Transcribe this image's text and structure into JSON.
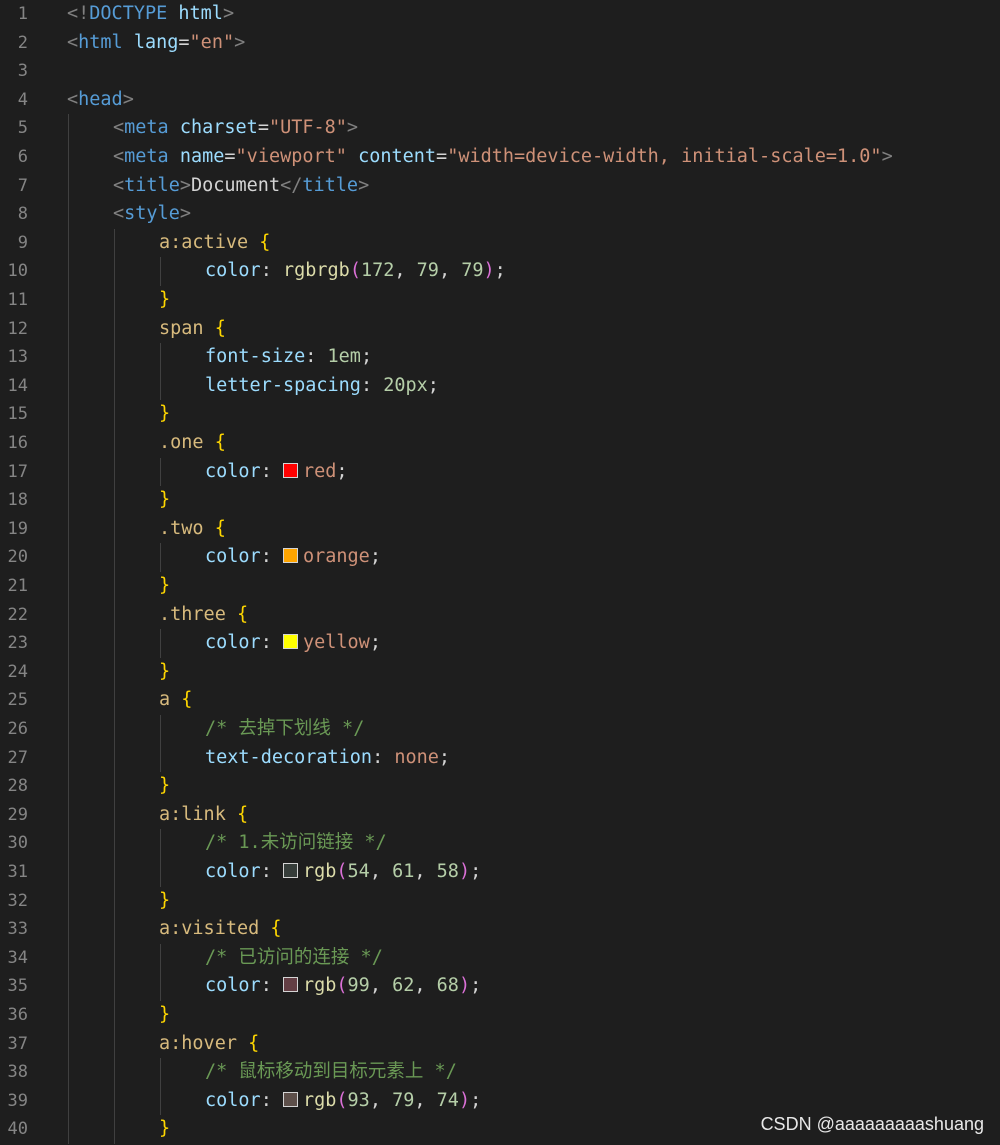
{
  "editor": {
    "theme_colors": {
      "background": "#1e1e1e",
      "line_number": "#858585",
      "tag": "#569cd6",
      "attribute": "#9cdcfe",
      "string": "#ce9178",
      "selector": "#d7ba7d",
      "brace": "#ffd700",
      "number": "#b5cea8",
      "function": "#dcdcaa",
      "paren": "#da70d6",
      "comment": "#6a9955"
    },
    "lines": [
      {
        "n": "1",
        "indent": 0,
        "tokens": [
          [
            "punct",
            "<!"
          ],
          [
            "tag",
            "DOCTYPE"
          ],
          [
            "text",
            " "
          ],
          [
            "attr",
            "html"
          ],
          [
            "punct",
            ">"
          ]
        ]
      },
      {
        "n": "2",
        "indent": 0,
        "tokens": [
          [
            "punct",
            "<"
          ],
          [
            "tag",
            "html"
          ],
          [
            "text",
            " "
          ],
          [
            "attr",
            "lang"
          ],
          [
            "eq",
            "="
          ],
          [
            "str",
            "\"en\""
          ],
          [
            "punct",
            ">"
          ]
        ]
      },
      {
        "n": "3",
        "indent": 0,
        "tokens": []
      },
      {
        "n": "4",
        "indent": 0,
        "tokens": [
          [
            "punct",
            "<"
          ],
          [
            "tag",
            "head"
          ],
          [
            "punct",
            ">"
          ]
        ]
      },
      {
        "n": "5",
        "indent": 1,
        "tokens": [
          [
            "punct",
            "<"
          ],
          [
            "tag",
            "meta"
          ],
          [
            "text",
            " "
          ],
          [
            "attr",
            "charset"
          ],
          [
            "eq",
            "="
          ],
          [
            "str",
            "\"UTF-8\""
          ],
          [
            "punct",
            ">"
          ]
        ]
      },
      {
        "n": "6",
        "indent": 1,
        "tokens": [
          [
            "punct",
            "<"
          ],
          [
            "tag",
            "meta"
          ],
          [
            "text",
            " "
          ],
          [
            "attr",
            "name"
          ],
          [
            "eq",
            "="
          ],
          [
            "str",
            "\"viewport\""
          ],
          [
            "text",
            " "
          ],
          [
            "attr",
            "content"
          ],
          [
            "eq",
            "="
          ],
          [
            "str",
            "\"width=device-width, initial-scale=1.0\""
          ],
          [
            "punct",
            ">"
          ]
        ]
      },
      {
        "n": "7",
        "indent": 1,
        "tokens": [
          [
            "punct",
            "<"
          ],
          [
            "tag",
            "title"
          ],
          [
            "punct",
            ">"
          ],
          [
            "text",
            "Document"
          ],
          [
            "punct",
            "</"
          ],
          [
            "tag",
            "title"
          ],
          [
            "punct",
            ">"
          ]
        ]
      },
      {
        "n": "8",
        "indent": 1,
        "tokens": [
          [
            "punct",
            "<"
          ],
          [
            "tag",
            "style"
          ],
          [
            "punct",
            ">"
          ]
        ]
      },
      {
        "n": "9",
        "indent": 2,
        "tokens": [
          [
            "sel",
            "a:active"
          ],
          [
            "text",
            " "
          ],
          [
            "brace",
            "{"
          ]
        ]
      },
      {
        "n": "10",
        "indent": 3,
        "tokens": [
          [
            "prop",
            "color"
          ],
          [
            "text",
            ": "
          ],
          [
            "func",
            "rgbrgb"
          ],
          [
            "paren",
            "("
          ],
          [
            "num",
            "172"
          ],
          [
            "text",
            ", "
          ],
          [
            "num",
            "79"
          ],
          [
            "text",
            ", "
          ],
          [
            "num",
            "79"
          ],
          [
            "paren",
            ")"
          ],
          [
            "text",
            ";"
          ]
        ]
      },
      {
        "n": "11",
        "indent": 2,
        "tokens": [
          [
            "brace",
            "}"
          ]
        ]
      },
      {
        "n": "12",
        "indent": 2,
        "tokens": [
          [
            "sel",
            "span"
          ],
          [
            "text",
            " "
          ],
          [
            "brace",
            "{"
          ]
        ]
      },
      {
        "n": "13",
        "indent": 3,
        "tokens": [
          [
            "prop",
            "font-size"
          ],
          [
            "text",
            ": "
          ],
          [
            "num",
            "1em"
          ],
          [
            "text",
            ";"
          ]
        ]
      },
      {
        "n": "14",
        "indent": 3,
        "tokens": [
          [
            "prop",
            "letter-spacing"
          ],
          [
            "text",
            ": "
          ],
          [
            "num",
            "20px"
          ],
          [
            "text",
            ";"
          ]
        ]
      },
      {
        "n": "15",
        "indent": 2,
        "tokens": [
          [
            "brace",
            "}"
          ]
        ]
      },
      {
        "n": "16",
        "indent": 2,
        "tokens": [
          [
            "sel",
            ".one"
          ],
          [
            "text",
            " "
          ],
          [
            "brace",
            "{"
          ]
        ]
      },
      {
        "n": "17",
        "indent": 3,
        "tokens": [
          [
            "prop",
            "color"
          ],
          [
            "text",
            ": "
          ],
          [
            "swatch",
            "#ff0000"
          ],
          [
            "str",
            "red"
          ],
          [
            "text",
            ";"
          ]
        ]
      },
      {
        "n": "18",
        "indent": 2,
        "tokens": [
          [
            "brace",
            "}"
          ]
        ]
      },
      {
        "n": "19",
        "indent": 2,
        "tokens": [
          [
            "sel",
            ".two"
          ],
          [
            "text",
            " "
          ],
          [
            "brace",
            "{"
          ]
        ]
      },
      {
        "n": "20",
        "indent": 3,
        "tokens": [
          [
            "prop",
            "color"
          ],
          [
            "text",
            ": "
          ],
          [
            "swatch",
            "#ffa500"
          ],
          [
            "str",
            "orange"
          ],
          [
            "text",
            ";"
          ]
        ]
      },
      {
        "n": "21",
        "indent": 2,
        "tokens": [
          [
            "brace",
            "}"
          ]
        ]
      },
      {
        "n": "22",
        "indent": 2,
        "tokens": [
          [
            "sel",
            ".three"
          ],
          [
            "text",
            " "
          ],
          [
            "brace",
            "{"
          ]
        ]
      },
      {
        "n": "23",
        "indent": 3,
        "tokens": [
          [
            "prop",
            "color"
          ],
          [
            "text",
            ": "
          ],
          [
            "swatch",
            "#ffff00"
          ],
          [
            "str",
            "yellow"
          ],
          [
            "text",
            ";"
          ]
        ]
      },
      {
        "n": "24",
        "indent": 2,
        "tokens": [
          [
            "brace",
            "}"
          ]
        ]
      },
      {
        "n": "25",
        "indent": 2,
        "tokens": [
          [
            "sel",
            "a"
          ],
          [
            "text",
            " "
          ],
          [
            "brace",
            "{"
          ]
        ]
      },
      {
        "n": "26",
        "indent": 3,
        "tokens": [
          [
            "comment",
            "/* 去掉下划线 */"
          ]
        ]
      },
      {
        "n": "27",
        "indent": 3,
        "tokens": [
          [
            "prop",
            "text-decoration"
          ],
          [
            "text",
            ": "
          ],
          [
            "str",
            "none"
          ],
          [
            "text",
            ";"
          ]
        ]
      },
      {
        "n": "28",
        "indent": 2,
        "tokens": [
          [
            "brace",
            "}"
          ]
        ]
      },
      {
        "n": "29",
        "indent": 2,
        "tokens": [
          [
            "sel",
            "a:link"
          ],
          [
            "text",
            " "
          ],
          [
            "brace",
            "{"
          ]
        ]
      },
      {
        "n": "30",
        "indent": 3,
        "tokens": [
          [
            "comment",
            "/* 1.未访问链接 */"
          ]
        ]
      },
      {
        "n": "31",
        "indent": 3,
        "tokens": [
          [
            "prop",
            "color"
          ],
          [
            "text",
            ": "
          ],
          [
            "swatch",
            "#363d3a"
          ],
          [
            "func",
            "rgb"
          ],
          [
            "paren",
            "("
          ],
          [
            "num",
            "54"
          ],
          [
            "text",
            ", "
          ],
          [
            "num",
            "61"
          ],
          [
            "text",
            ", "
          ],
          [
            "num",
            "58"
          ],
          [
            "paren",
            ")"
          ],
          [
            "text",
            ";"
          ]
        ]
      },
      {
        "n": "32",
        "indent": 2,
        "tokens": [
          [
            "brace",
            "}"
          ]
        ]
      },
      {
        "n": "33",
        "indent": 2,
        "tokens": [
          [
            "sel",
            "a:visited"
          ],
          [
            "text",
            " "
          ],
          [
            "brace",
            "{"
          ]
        ]
      },
      {
        "n": "34",
        "indent": 3,
        "tokens": [
          [
            "comment",
            "/* 已访问的连接 */"
          ]
        ]
      },
      {
        "n": "35",
        "indent": 3,
        "tokens": [
          [
            "prop",
            "color"
          ],
          [
            "text",
            ": "
          ],
          [
            "swatch",
            "#633e44"
          ],
          [
            "func",
            "rgb"
          ],
          [
            "paren",
            "("
          ],
          [
            "num",
            "99"
          ],
          [
            "text",
            ", "
          ],
          [
            "num",
            "62"
          ],
          [
            "text",
            ", "
          ],
          [
            "num",
            "68"
          ],
          [
            "paren",
            ")"
          ],
          [
            "text",
            ";"
          ]
        ]
      },
      {
        "n": "36",
        "indent": 2,
        "tokens": [
          [
            "brace",
            "}"
          ]
        ]
      },
      {
        "n": "37",
        "indent": 2,
        "tokens": [
          [
            "sel",
            "a:hover"
          ],
          [
            "text",
            " "
          ],
          [
            "brace",
            "{"
          ]
        ]
      },
      {
        "n": "38",
        "indent": 3,
        "tokens": [
          [
            "comment",
            "/* 鼠标移动到目标元素上 */"
          ]
        ]
      },
      {
        "n": "39",
        "indent": 3,
        "tokens": [
          [
            "prop",
            "color"
          ],
          [
            "text",
            ": "
          ],
          [
            "swatch",
            "#5d4f4a"
          ],
          [
            "func",
            "rgb"
          ],
          [
            "paren",
            "("
          ],
          [
            "num",
            "93"
          ],
          [
            "text",
            ", "
          ],
          [
            "num",
            "79"
          ],
          [
            "text",
            ", "
          ],
          [
            "num",
            "74"
          ],
          [
            "paren",
            ")"
          ],
          [
            "text",
            ";"
          ]
        ]
      },
      {
        "n": "40",
        "indent": 2,
        "tokens": [
          [
            "brace",
            "}"
          ]
        ]
      }
    ]
  },
  "watermark": "CSDN @aaaaaaaaashuang"
}
